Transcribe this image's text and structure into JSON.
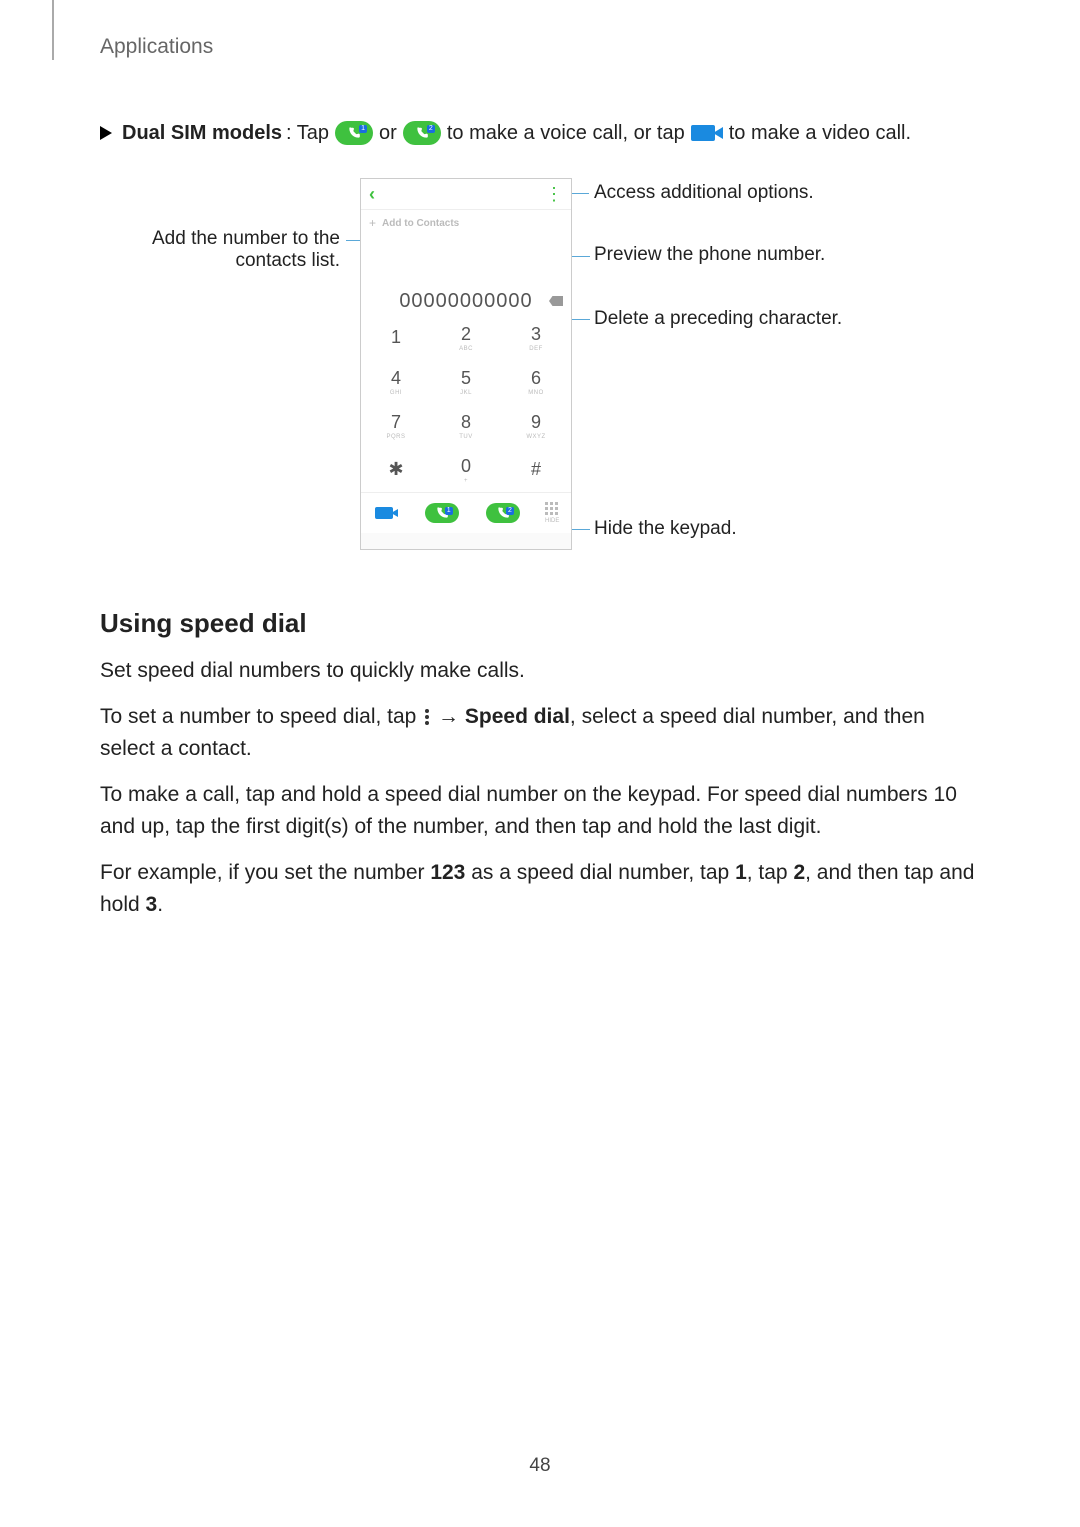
{
  "header": {
    "section": "Applications"
  },
  "intro": {
    "prefix_bold": "Dual SIM models",
    "prefix_tail": ": Tap ",
    "mid1": " or ",
    "mid2": " to make a voice call, or tap ",
    "tail": " to make a video call."
  },
  "callouts": {
    "add_contacts": "Add the number to the contacts list.",
    "access_options": "Access additional options.",
    "preview_number": "Preview the phone number.",
    "delete_char": "Delete a preceding character.",
    "hide_keypad": "Hide the keypad."
  },
  "phone": {
    "add_to_contacts": "Add to Contacts",
    "number_display": "00000000000",
    "keys": [
      {
        "d": "1",
        "s": ""
      },
      {
        "d": "2",
        "s": "ABC"
      },
      {
        "d": "3",
        "s": "DEF"
      },
      {
        "d": "4",
        "s": "GHI"
      },
      {
        "d": "5",
        "s": "JKL"
      },
      {
        "d": "6",
        "s": "MNO"
      },
      {
        "d": "7",
        "s": "PQRS"
      },
      {
        "d": "8",
        "s": "TUV"
      },
      {
        "d": "9",
        "s": "WXYZ"
      },
      {
        "d": "✱",
        "s": ""
      },
      {
        "d": "0",
        "s": "+"
      },
      {
        "d": "#",
        "s": ""
      }
    ],
    "sim_badges": [
      "1",
      "2"
    ],
    "hide_label": "HIDE"
  },
  "speed_dial": {
    "heading": "Using speed dial",
    "p1": "Set speed dial numbers to quickly make calls.",
    "p2a": "To set a number to speed dial, tap ",
    "p2b": " → ",
    "p2c_bold": "Speed dial",
    "p2d": ", select a speed dial number, and then select a contact.",
    "p3": "To make a call, tap and hold a speed dial number on the keypad. For speed dial numbers 10 and up, tap the first digit(s) of the number, and then tap and hold the last digit.",
    "p4a": "For example, if you set the number ",
    "p4_num": "123",
    "p4b": " as a speed dial number, tap ",
    "p4_k1": "1",
    "p4c": ", tap ",
    "p4_k2": "2",
    "p4d": ", and then tap and hold ",
    "p4_k3": "3",
    "p4e": "."
  },
  "page_number": "48"
}
